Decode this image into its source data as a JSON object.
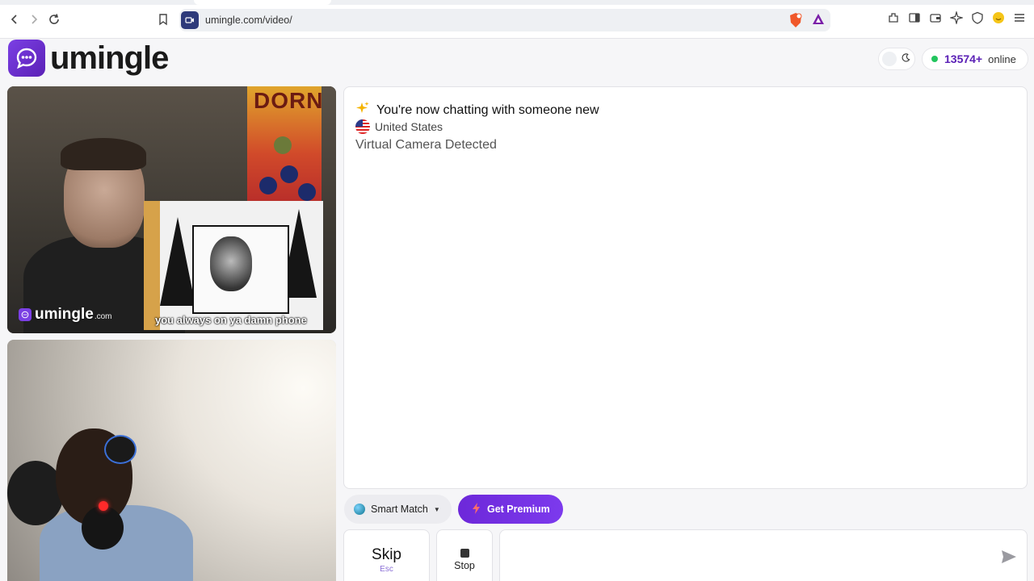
{
  "browser": {
    "url": "umingle.com/video/"
  },
  "header": {
    "logo_text": "umingle",
    "online_count": "13574+",
    "online_label": "online",
    "theme_icon": "moon-icon"
  },
  "video": {
    "watermark_text": "umingle",
    "watermark_suffix": ".com",
    "caption": "you always on ya damn phone",
    "poster_title": "DORN"
  },
  "chat": {
    "status_message": "You're now chatting with someone new",
    "country": "United States",
    "notice": "Virtual Camera Detected"
  },
  "controls": {
    "smart_match_label": "Smart Match",
    "premium_label": "Get Premium",
    "skip_label": "Skip",
    "skip_shortcut": "Esc",
    "stop_label": "Stop",
    "message_placeholder": ""
  },
  "colors": {
    "brand_purple": "#6d28d9",
    "online_green": "#22c55e"
  }
}
